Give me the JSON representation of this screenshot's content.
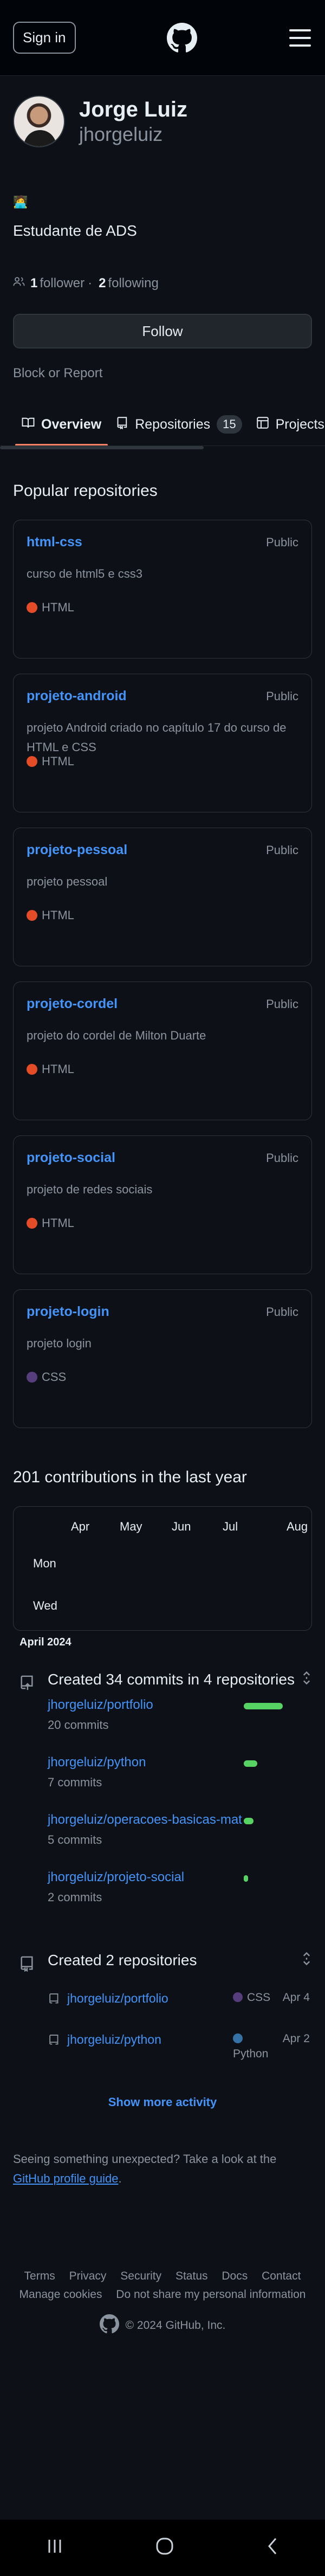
{
  "header": {
    "signin_label": "Sign in"
  },
  "profile": {
    "name": "Jorge Luiz",
    "login": "jhorgeluiz",
    "status_emoji": "🧑‍💻",
    "bio": "Estudante de ADS",
    "followers_count": "1",
    "followers_label": "follower",
    "separator": "·",
    "following_count": "2",
    "following_label": "following",
    "follow_label": "Follow",
    "block_label": "Block or Report"
  },
  "tabs": [
    {
      "label": "Overview"
    },
    {
      "label": "Repositories",
      "count": "15"
    },
    {
      "label": "Projects"
    }
  ],
  "popular": {
    "title": "Popular repositories",
    "repos": [
      {
        "name": "html-css",
        "visibility": "Public",
        "description": "curso de html5 e css3",
        "language": "HTML",
        "lang_color": "#e34c26"
      },
      {
        "name": "projeto-android",
        "visibility": "Public",
        "description": "projeto Android criado no capítulo 17 do curso de HTML e CSS",
        "language": "HTML",
        "lang_color": "#e34c26"
      },
      {
        "name": "projeto-pessoal",
        "visibility": "Public",
        "description": "projeto pessoal",
        "language": "HTML",
        "lang_color": "#e34c26"
      },
      {
        "name": "projeto-cordel",
        "visibility": "Public",
        "description": "projeto do cordel de Milton Duarte",
        "language": "HTML",
        "lang_color": "#e34c26"
      },
      {
        "name": "projeto-social",
        "visibility": "Public",
        "description": "projeto de redes sociais",
        "language": "HTML",
        "lang_color": "#e34c26"
      },
      {
        "name": "projeto-login",
        "visibility": "Public",
        "description": "projeto login",
        "language": "CSS",
        "lang_color": "#563d7c"
      }
    ]
  },
  "contributions": {
    "title": "201 contributions in the last year",
    "months": [
      "Apr",
      "May",
      "Jun",
      "Jul",
      "Aug"
    ],
    "days": [
      "Mon",
      "Wed"
    ],
    "year_label": "April 2024"
  },
  "activity": {
    "commits_title": "Created 34 commits in 4 repositories",
    "commits": [
      {
        "repo": "jhorgeluiz/portfolio",
        "count": "20 commits",
        "share": 20
      },
      {
        "repo": "jhorgeluiz/python",
        "count": "7 commits",
        "share": 7
      },
      {
        "repo": "jhorgeluiz/operacoes-basicas-mat",
        "count": "5 commits",
        "share": 5
      },
      {
        "repo": "jhorgeluiz/projeto-social",
        "count": "2 commits",
        "share": 2
      }
    ],
    "created_title": "Created 2 repositories",
    "created": [
      {
        "repo": "jhorgeluiz/portfolio",
        "language": "CSS",
        "lang_color": "#563d7c",
        "date": "Apr 4"
      },
      {
        "repo": "jhorgeluiz/python",
        "language": "Python",
        "lang_color": "#3572a5",
        "date": "Apr 2"
      }
    ],
    "show_more": "Show more activity"
  },
  "unexpected": {
    "text": "Seeing something unexpected? Take a look at the ",
    "link": "GitHub profile guide",
    "end": "."
  },
  "footer": {
    "links": [
      "Terms",
      "Privacy",
      "Security",
      "Status",
      "Docs",
      "Contact"
    ],
    "links2": [
      "Manage cookies",
      "Do not share my personal information"
    ],
    "copyright": "© 2024 GitHub, Inc."
  }
}
